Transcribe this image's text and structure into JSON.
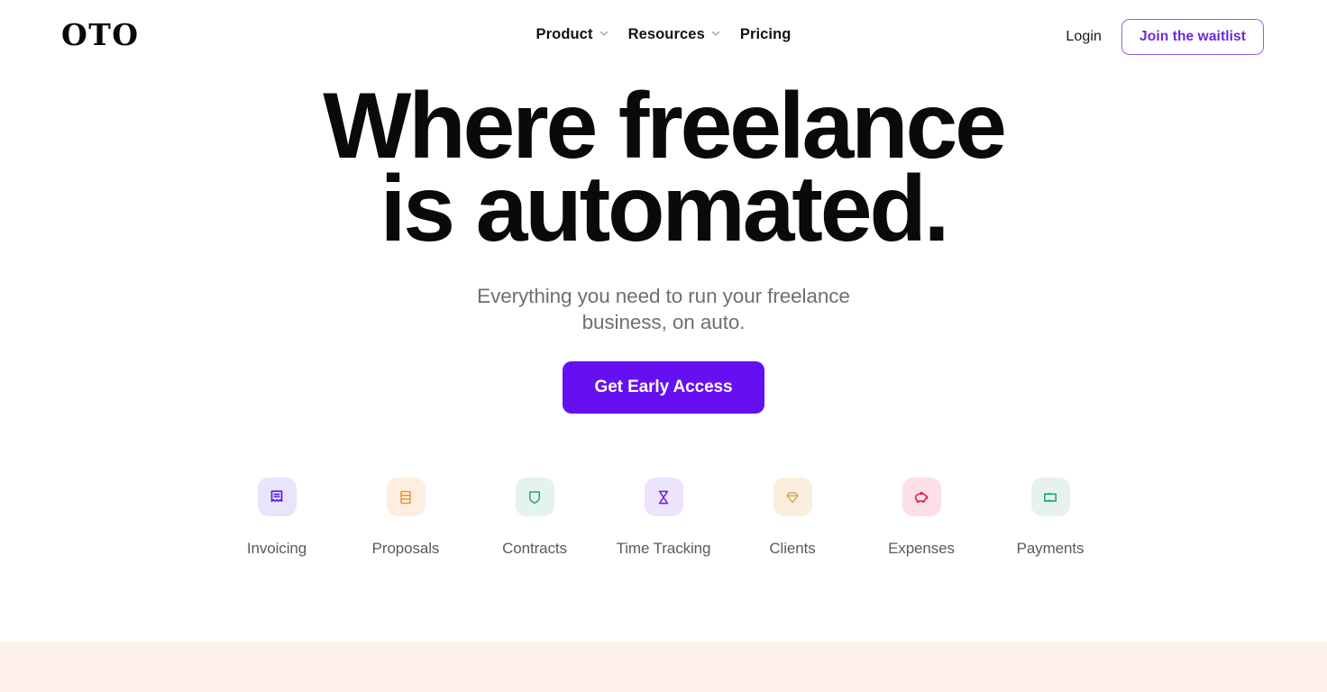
{
  "brand": {
    "logo_text": "OTO",
    "accent_purple": "#6610f2",
    "accent_purple_outline": "#6d28d9"
  },
  "header": {
    "nav": [
      {
        "label": "Product",
        "has_dropdown": true,
        "icon": "chevron-down-icon"
      },
      {
        "label": "Resources",
        "has_dropdown": true,
        "icon": "chevron-down-icon"
      },
      {
        "label": "Pricing",
        "has_dropdown": false,
        "icon": ""
      }
    ],
    "login_label": "Login",
    "waitlist_label": "Join the waitlist"
  },
  "hero": {
    "headline_line1": "Where freelance",
    "headline_line2": "is automated.",
    "subhead": "Everything you need to run your freelance business, on auto.",
    "cta_label": "Get Early Access"
  },
  "features": [
    {
      "label": "Invoicing",
      "icon": "receipt-icon",
      "icon_color": "#5b21e8",
      "bg_color": "#e9e3fb"
    },
    {
      "label": "Proposals",
      "icon": "document-icon",
      "icon_color": "#e8963c",
      "bg_color": "#fdeee0"
    },
    {
      "label": "Contracts",
      "icon": "shield-icon",
      "icon_color": "#2f9e7a",
      "bg_color": "#e4f4ec"
    },
    {
      "label": "Time Tracking",
      "icon": "hourglass-icon",
      "icon_color": "#6d28d9",
      "bg_color": "#ebe4fb"
    },
    {
      "label": "Clients",
      "icon": "diamond-icon",
      "icon_color": "#d9a259",
      "bg_color": "#fbeedd"
    },
    {
      "label": "Expenses",
      "icon": "piggybank-icon",
      "icon_color": "#d6204f",
      "bg_color": "#fcdfe7"
    },
    {
      "label": "Payments",
      "icon": "wallet-icon",
      "icon_color": "#15a07b",
      "bg_color": "#e7f2ec"
    }
  ],
  "bottom_band": {
    "background_color": "#fdf1ea"
  }
}
